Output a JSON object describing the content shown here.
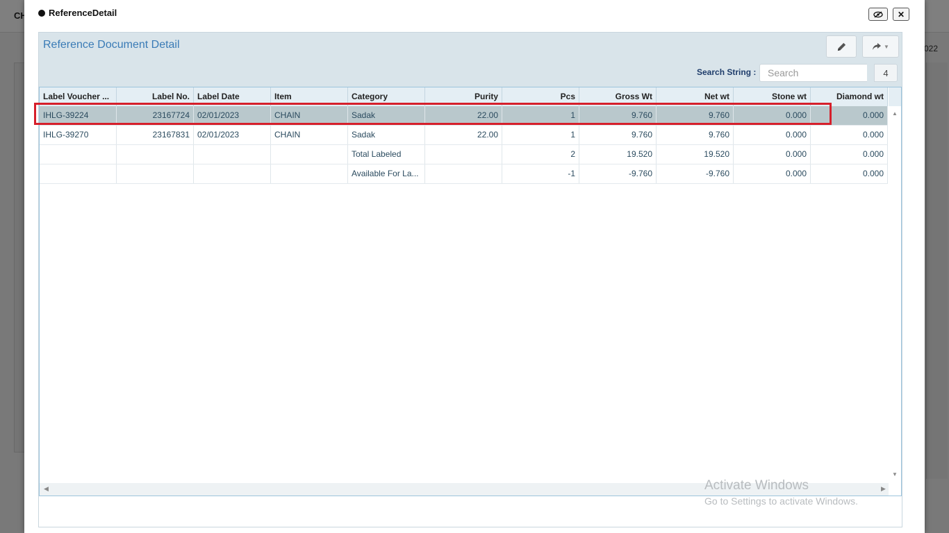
{
  "background": {
    "title": "CH",
    "date_fragment": "022"
  },
  "modal": {
    "title": "ReferenceDetail"
  },
  "panel": {
    "title": "Reference Document Detail",
    "search_label": "Search String :",
    "search_placeholder": "Search",
    "search_count": "4"
  },
  "grid": {
    "columns": [
      "Label Voucher ...",
      "Label No.",
      "Label Date",
      "Item",
      "Category",
      "Purity",
      "Pcs",
      "Gross Wt",
      "Net wt",
      "Stone wt",
      "Diamond wt"
    ],
    "rows": [
      [
        "IHLG-39224",
        "23167724",
        "02/01/2023",
        "CHAIN",
        "Sadak",
        "22.00",
        "1",
        "9.760",
        "9.760",
        "0.000",
        "0.000"
      ],
      [
        "IHLG-39270",
        "23167831",
        "02/01/2023",
        "CHAIN",
        "Sadak",
        "22.00",
        "1",
        "9.760",
        "9.760",
        "0.000",
        "0.000"
      ],
      [
        "",
        "",
        "",
        "",
        "Total Labeled",
        "",
        "2",
        "19.520",
        "19.520",
        "0.000",
        "0.000"
      ],
      [
        "",
        "",
        "",
        "",
        "Available For La...",
        "",
        "-1",
        "-9.760",
        "-9.760",
        "0.000",
        "0.000"
      ]
    ],
    "selected_row": 0
  },
  "watermark": {
    "line1": "Activate Windows",
    "line2": "Go to Settings to activate Windows."
  }
}
